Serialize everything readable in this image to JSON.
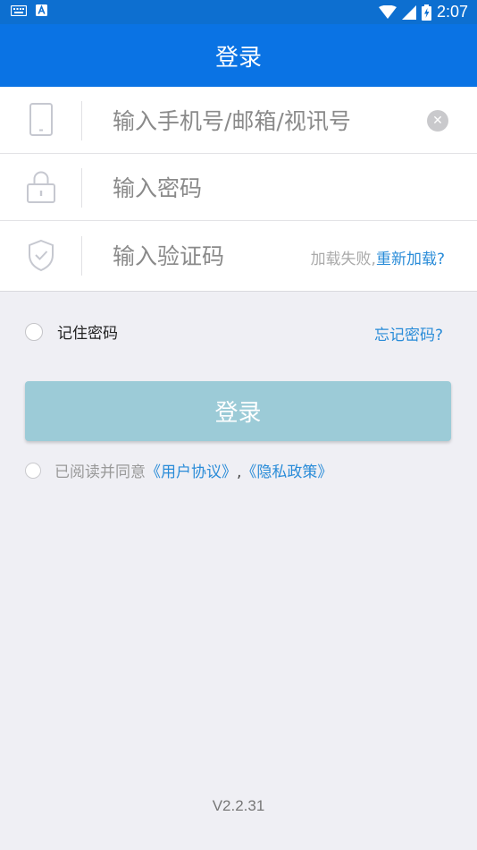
{
  "status_bar": {
    "time": "2:07"
  },
  "header": {
    "title": "登录"
  },
  "form": {
    "phone_placeholder": "输入手机号/邮箱/视讯号",
    "password_placeholder": "输入密码",
    "captcha_placeholder": "输入验证码",
    "captcha_failed": "加载失败,",
    "captcha_reload": "重新加载?"
  },
  "options": {
    "remember_label": "记住密码",
    "forgot_label": "忘记密码?"
  },
  "login_button": "登录",
  "agreement": {
    "prefix": "已阅读并同意",
    "user_agreement": "《用户协议》",
    "separator": ",",
    "privacy_policy": "《隐私政策》"
  },
  "version": "V2.2.31",
  "colors": {
    "status_bar": "#0d6fd0",
    "app_bar": "#0a73e4",
    "link": "#2a8cd8",
    "button": "#9ccbd7",
    "background": "#efeff4"
  },
  "icons": {
    "status_left": [
      "keyboard-icon",
      "text-a-icon"
    ],
    "status_right": [
      "wifi-icon",
      "signal-icon",
      "battery-icon"
    ],
    "fields": [
      "phone-icon",
      "lock-icon",
      "shield-check-icon"
    ]
  }
}
